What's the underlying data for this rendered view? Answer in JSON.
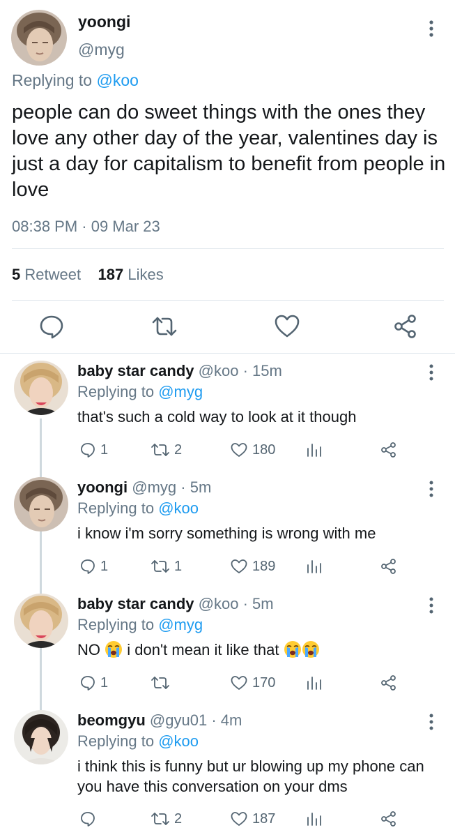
{
  "main_tweet": {
    "author_name": "yoongi",
    "author_handle": "@myg",
    "replying_prefix": "Replying to",
    "replying_handle": "@koo",
    "text": "people can do sweet things with the ones they love any other day of the year, valentines day is just a day for capitalism to benefit from people in love",
    "timestamp": "08:38 PM · 09 Mar 23",
    "retweet_count": "5",
    "retweet_label": "Retweet",
    "like_count": "187",
    "like_label": "Likes"
  },
  "replies": [
    {
      "name": "baby star candy",
      "handle": "@koo",
      "time": "· 15m",
      "replying_prefix": "Replying to",
      "replying_handle": "@myg",
      "text": "that's such a cold way to look at it though",
      "reply_count": "1",
      "retweet_count": "2",
      "like_count": "180"
    },
    {
      "name": "yoongi",
      "handle": "@myg",
      "time": "· 5m",
      "replying_prefix": "Replying to",
      "replying_handle": "@koo",
      "text": "i know i'm sorry something is wrong with me",
      "reply_count": "1",
      "retweet_count": "1",
      "like_count": "189"
    },
    {
      "name": "baby star candy",
      "handle": "@koo",
      "time": "· 5m",
      "replying_prefix": "Replying to",
      "replying_handle": "@myg",
      "text_part1": "NO",
      "text_part2": "i don't mean it like that",
      "reply_count": "1",
      "retweet_count": "",
      "like_count": "170"
    },
    {
      "name": "beomgyu",
      "handle": "@gyu01",
      "time": "· 4m",
      "replying_prefix": "Replying to",
      "replying_handle": "@koo",
      "text": "i think this is funny but ur blowing up my phone can you have this conversation on your dms",
      "reply_count": "",
      "retweet_count": "2",
      "like_count": "187"
    }
  ],
  "icons": {
    "reply": "reply-bubble-icon",
    "retweet": "retweet-icon",
    "like": "heart-icon",
    "share": "share-icon",
    "analytics": "analytics-bars-icon",
    "more": "more-vertical-icon",
    "emoji": "loudly-crying-face-emoji"
  },
  "colors": {
    "link": "#1d9bf0",
    "secondary_text": "#657786",
    "icon": "#536471",
    "divider": "#e1e8ed",
    "thread_line": "#cfd9de"
  }
}
